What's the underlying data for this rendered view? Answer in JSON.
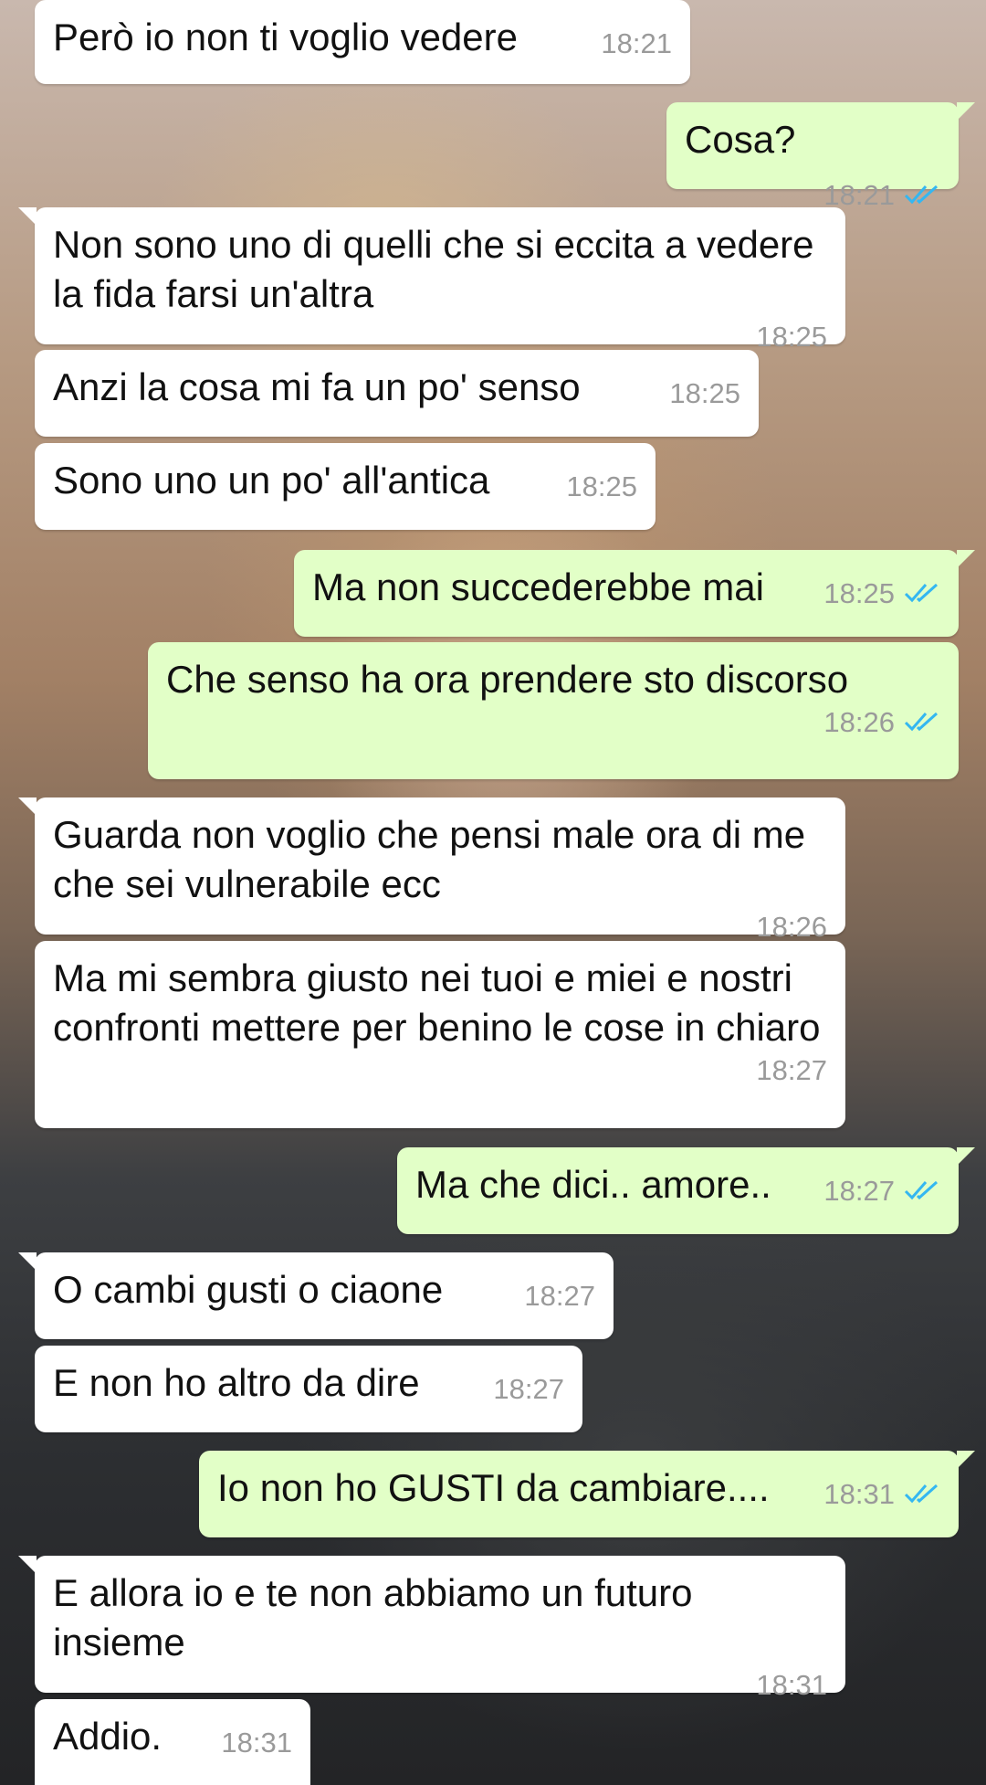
{
  "messages": [
    {
      "dir": "in",
      "text": "Però io non ti voglio vedere",
      "time": "18:21"
    },
    {
      "dir": "out",
      "text": "Cosa?",
      "time": "18:21",
      "read": true
    },
    {
      "dir": "in",
      "text": "Non sono uno di quelli che si eccita a vedere la fida farsi un'altra",
      "time": "18:25"
    },
    {
      "dir": "in",
      "text": "Anzi la cosa mi fa un po' senso",
      "time": "18:25"
    },
    {
      "dir": "in",
      "text": "Sono uno un po' all'antica",
      "time": "18:25"
    },
    {
      "dir": "out",
      "text": "Ma non succederebbe mai",
      "time": "18:25",
      "read": true
    },
    {
      "dir": "out",
      "text": "Che senso ha ora prendere sto discorso",
      "time": "18:26",
      "read": true
    },
    {
      "dir": "in",
      "text": "Guarda non voglio che pensi male ora di me che sei vulnerabile ecc",
      "time": "18:26"
    },
    {
      "dir": "in",
      "text": "Ma mi sembra giusto nei tuoi e miei e nostri confronti mettere per benino le cose in chiaro",
      "time": "18:27"
    },
    {
      "dir": "out",
      "text": "Ma che dici.. amore..",
      "time": "18:27",
      "read": true
    },
    {
      "dir": "in",
      "text": "O cambi gusti o ciaone",
      "time": "18:27"
    },
    {
      "dir": "in",
      "text": "E non ho altro da dire",
      "time": "18:27"
    },
    {
      "dir": "out",
      "text": "Io non ho GUSTI da cambiare....",
      "time": "18:31",
      "read": true
    },
    {
      "dir": "in",
      "text": "E allora io e te non abbiamo un futuro insieme",
      "time": "18:31"
    },
    {
      "dir": "in",
      "text": "Addio.",
      "time": "18:31"
    }
  ],
  "colors": {
    "incoming": "#ffffff",
    "outgoing": "#e2ffc7",
    "read_ticks": "#34b7f1",
    "timestamp": "#9a9a9a"
  },
  "icons": {
    "read_receipt": "double-check-icon"
  }
}
